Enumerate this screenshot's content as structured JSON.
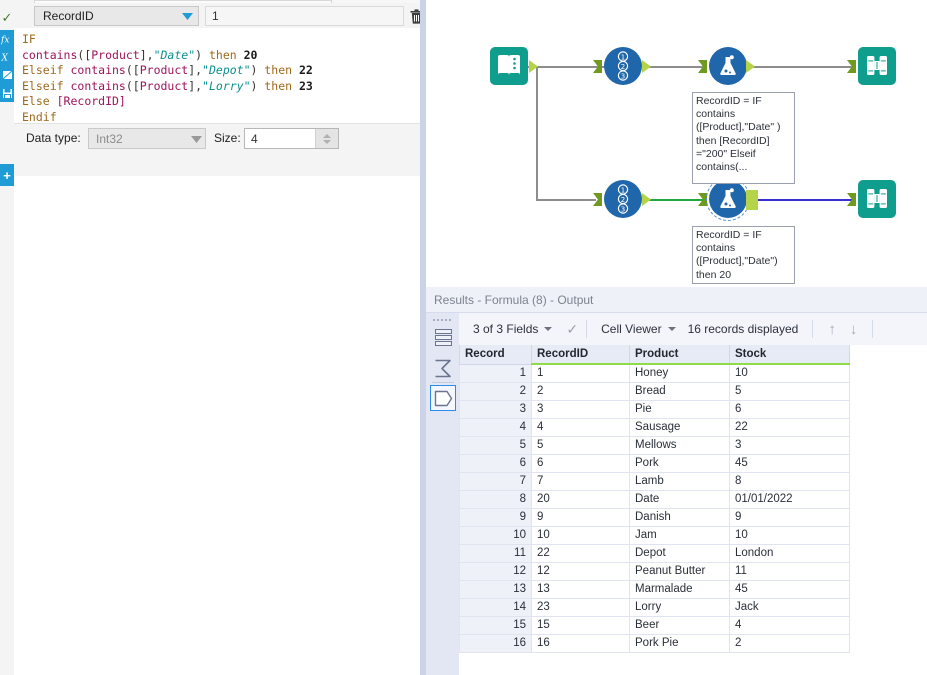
{
  "config_panel": {
    "rail_icons": [
      "check-icon",
      "fx-icon",
      "xy-icon",
      "window-icon",
      "save-icon",
      "plus-icon"
    ],
    "field_select": {
      "value": "RecordID",
      "caret": "chevron-down-icon"
    },
    "expression_input": {
      "value": "1"
    },
    "delete_button": {
      "icon": "trash-icon",
      "label": ""
    },
    "formula_lines": [
      [
        {
          "t": "IF",
          "c": "kw"
        }
      ],
      [
        {
          "t": "contains",
          "c": "fn"
        },
        {
          "t": "([",
          "c": "pun"
        },
        {
          "t": "Product",
          "c": "fld"
        },
        {
          "t": "],",
          "c": "pun"
        },
        {
          "t": "\"Date\"",
          "c": "str"
        },
        {
          "t": ") ",
          "c": "pun"
        },
        {
          "t": "then ",
          "c": "kw"
        },
        {
          "t": "20",
          "c": "num"
        }
      ],
      [
        {
          "t": "Elseif ",
          "c": "kw"
        },
        {
          "t": "contains",
          "c": "fn"
        },
        {
          "t": "([",
          "c": "pun"
        },
        {
          "t": "Product",
          "c": "fld"
        },
        {
          "t": "],",
          "c": "pun"
        },
        {
          "t": "\"Depot\"",
          "c": "str"
        },
        {
          "t": ") ",
          "c": "pun"
        },
        {
          "t": "then ",
          "c": "kw"
        },
        {
          "t": "22",
          "c": "num"
        }
      ],
      [
        {
          "t": "Elseif ",
          "c": "kw"
        },
        {
          "t": "contains",
          "c": "fn"
        },
        {
          "t": "([",
          "c": "pun"
        },
        {
          "t": "Product",
          "c": "fld"
        },
        {
          "t": "],",
          "c": "pun"
        },
        {
          "t": "\"Lorry\"",
          "c": "str"
        },
        {
          "t": ") ",
          "c": "pun"
        },
        {
          "t": "then ",
          "c": "kw"
        },
        {
          "t": "23",
          "c": "num"
        }
      ],
      [
        {
          "t": "Else ",
          "c": "kw"
        },
        {
          "t": "[RecordID]",
          "c": "fld"
        }
      ],
      [
        {
          "t": "Endif",
          "c": "kw"
        }
      ]
    ],
    "data_type": {
      "label": "Data type:",
      "value": "Int32",
      "caret": "chevron-down-icon"
    },
    "size": {
      "label": "Size:",
      "value": "4"
    }
  },
  "canvas": {
    "nodes": [
      {
        "id": "input",
        "name": "input-data-tool",
        "icon": "book-icon",
        "shape": "square"
      },
      {
        "id": "recordid-1",
        "name": "record-id-tool-1",
        "icon": "numbers-123-icon",
        "shape": "circle"
      },
      {
        "id": "formula-1",
        "name": "formula-tool-1",
        "icon": "flask-icon",
        "shape": "circle"
      },
      {
        "id": "browse-1",
        "name": "browse-tool-1",
        "icon": "binoculars-icon",
        "shape": "square"
      },
      {
        "id": "recordid-2",
        "name": "record-id-tool-2",
        "icon": "numbers-123-icon",
        "shape": "circle"
      },
      {
        "id": "formula-2",
        "name": "formula-tool-2",
        "icon": "flask-icon",
        "shape": "circle",
        "selected": true
      },
      {
        "id": "browse-2",
        "name": "browse-tool-2",
        "icon": "binoculars-icon",
        "shape": "square"
      }
    ],
    "tooltips": [
      {
        "id": "tip-top",
        "text": "RecordID = IF contains ([Product],\"Date\" ) then [RecordID] =\"200\" Elseif contains(..."
      },
      {
        "id": "tip-bottom",
        "text": "RecordID = IF contains ([Product],\"Date\") then 20"
      }
    ],
    "connection_colors": {
      "default": "#8d8d8d",
      "green": "#1faa3f",
      "blue": "#3b2fcf"
    }
  },
  "results": {
    "title": "Results - Formula (8) - Output",
    "rail_icons": [
      "grid-icon",
      "sigma-icon",
      "data-shape-icon"
    ],
    "toolbar": {
      "fields_label": "3 of 3 Fields",
      "fields_caret": "chevron-down-icon",
      "check_icon": "check-icon",
      "viewer_label": "Cell Viewer",
      "viewer_caret": "chevron-down-icon",
      "records_label": "16 records displayed",
      "up_arrow": "arrow-up-icon",
      "down_arrow": "arrow-down-icon"
    },
    "table": {
      "columns": [
        "Record",
        "RecordID",
        "Product",
        "Stock"
      ],
      "highlighted_columns": [
        "RecordID",
        "Product",
        "Stock"
      ],
      "rows": [
        [
          "1",
          "1",
          "Honey",
          "10"
        ],
        [
          "2",
          "2",
          "Bread",
          "5"
        ],
        [
          "3",
          "3",
          "Pie",
          "6"
        ],
        [
          "4",
          "4",
          "Sausage",
          "22"
        ],
        [
          "5",
          "5",
          "Mellows",
          "3"
        ],
        [
          "6",
          "6",
          "Pork",
          "45"
        ],
        [
          "7",
          "7",
          "Lamb",
          "8"
        ],
        [
          "8",
          "20",
          "Date",
          "01/01/2022"
        ],
        [
          "9",
          "9",
          "Danish",
          "9"
        ],
        [
          "10",
          "10",
          "Jam",
          "10"
        ],
        [
          "11",
          "22",
          "Depot",
          "London"
        ],
        [
          "12",
          "12",
          "Peanut Butter",
          "11"
        ],
        [
          "13",
          "13",
          "Marmalade",
          "45"
        ],
        [
          "14",
          "23",
          "Lorry",
          "Jack"
        ],
        [
          "15",
          "15",
          "Beer",
          "4"
        ],
        [
          "16",
          "16",
          "Pork Pie",
          "2"
        ]
      ]
    }
  },
  "colors": {
    "tool_teal": "#0f9e8e",
    "tool_blue": "#1f66ab",
    "anchor_green": "#b5d44a",
    "header_highlight": "#8fdc4a",
    "accent_blue": "#1f9cd6"
  }
}
